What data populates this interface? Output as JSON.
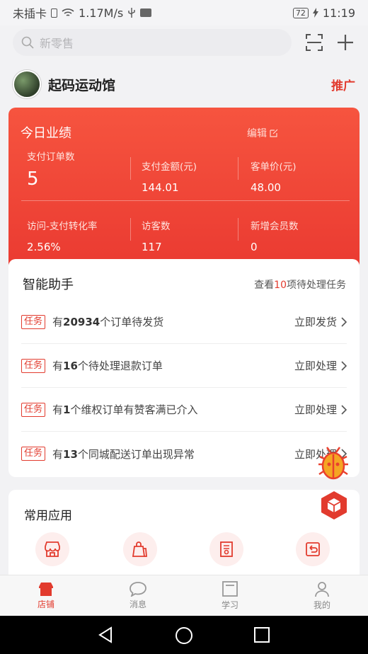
{
  "status": {
    "carrier": "未插卡",
    "speed": "1.17M/s",
    "battery": "72",
    "time": "11:19"
  },
  "search": {
    "placeholder": "新零售"
  },
  "shop": {
    "name": "起码运动馆",
    "promote": "推广"
  },
  "performance": {
    "title": "今日业绩",
    "edit": "编辑",
    "metrics": [
      {
        "label": "支付订单数",
        "value": "5"
      },
      {
        "label": "支付金额(元)",
        "value": "144.01"
      },
      {
        "label": "客单价(元)",
        "value": "48.00"
      },
      {
        "label": "访问-支付转化率",
        "value": "2.56%"
      },
      {
        "label": "访客数",
        "value": "117"
      },
      {
        "label": "新增会员数",
        "value": "0"
      }
    ]
  },
  "assistant": {
    "title": "智能助手",
    "link_prefix": "查看",
    "link_count": "10",
    "link_suffix": "项待处理任务",
    "tasks": [
      {
        "tag": "任务",
        "prefix": "有",
        "count": "20934",
        "suffix": "个订单待发货",
        "action": "立即发货"
      },
      {
        "tag": "任务",
        "prefix": "有",
        "count": "16",
        "suffix": "个待处理退款订单",
        "action": "立即处理"
      },
      {
        "tag": "任务",
        "prefix": "有",
        "count": "1",
        "suffix": "个维权订单有赞客满已介入",
        "action": "立即处理"
      },
      {
        "tag": "任务",
        "prefix": "有",
        "count": "13",
        "suffix": "个同城配送订单出现异常",
        "action": "立即处理"
      }
    ]
  },
  "apps": {
    "title": "常用应用",
    "icons": [
      "store-icon",
      "shopping-bag-icon",
      "certificate-icon",
      "return-icon"
    ]
  },
  "nav": [
    {
      "label": "店铺",
      "icon": "store-icon",
      "active": true
    },
    {
      "label": "消息",
      "icon": "chat-bubble-icon",
      "active": false
    },
    {
      "label": "学习",
      "icon": "book-icon",
      "active": false
    },
    {
      "label": "我的",
      "icon": "person-icon",
      "active": false
    }
  ],
  "colors": {
    "accent": "#e23b2e",
    "card_gradient_top": "#f6543f",
    "card_gradient_bottom": "#ea3a31"
  }
}
